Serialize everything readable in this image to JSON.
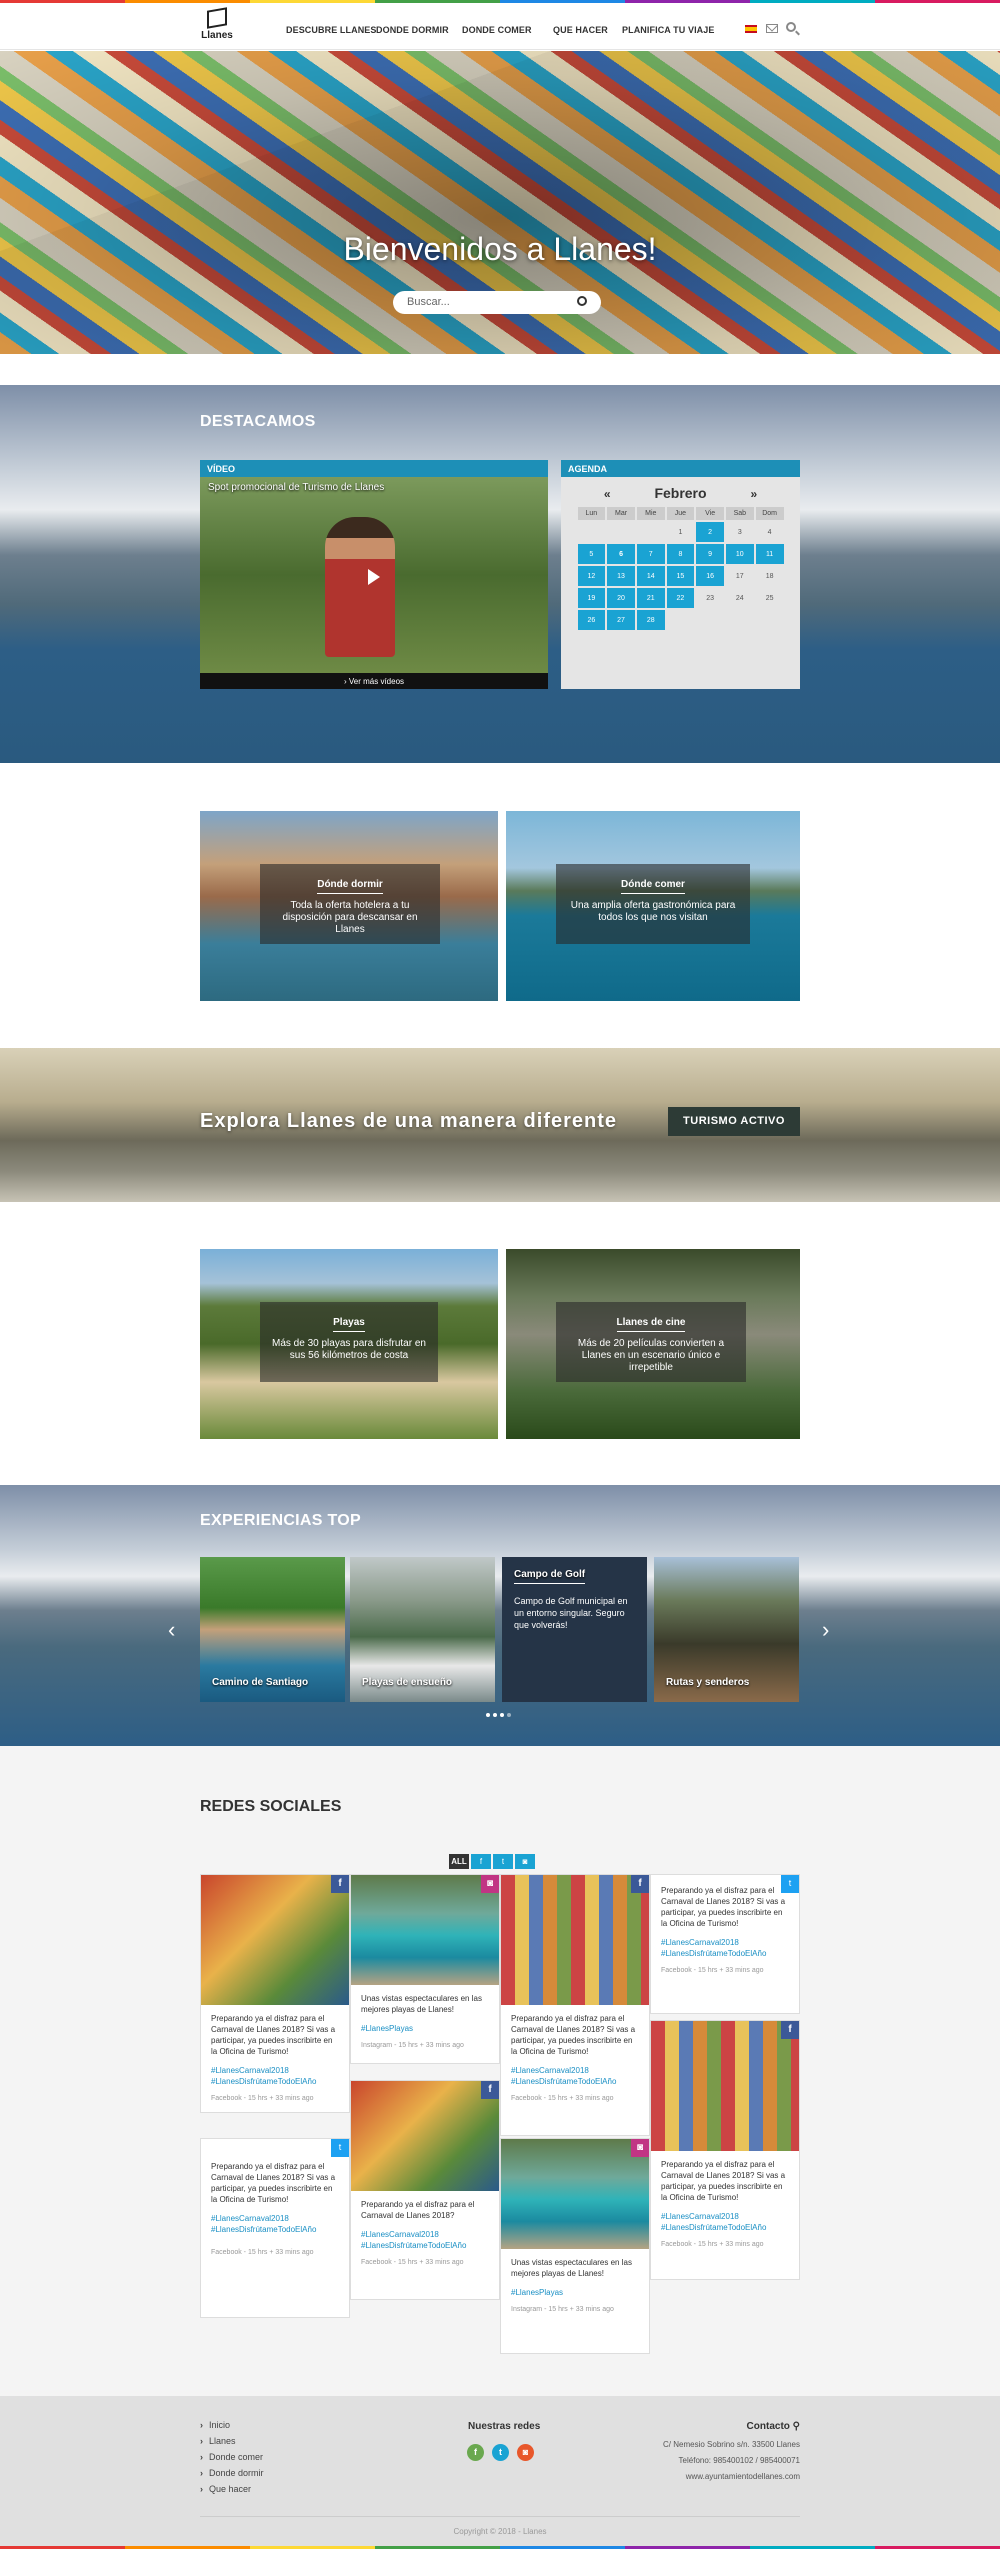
{
  "nav": {
    "logo_text": "Llanes",
    "links": [
      "DESCUBRE LLANES",
      "DONDE DORMIR",
      "DONDE COMER",
      "QUE HACER",
      "PLANIFICA TU VIAJE"
    ]
  },
  "hero": {
    "title": "Bienvenidos a Llanes!",
    "search_placeholder": "Buscar..."
  },
  "destacamos": {
    "title": "DESTACAMOS",
    "video": {
      "header": "VÍDEO",
      "title": "Spot promocional de Turismo de Llanes",
      "more": "Ver más vídeos"
    },
    "agenda": {
      "header": "AGENDA",
      "prev": "«",
      "month": "Febrero",
      "next": "»",
      "weekdays": [
        "Lun",
        "Mar",
        "Mie",
        "Jue",
        "Vie",
        "Sab",
        "Dom"
      ],
      "weeks": [
        [
          "",
          "",
          "",
          "1",
          "2",
          "3",
          "4"
        ],
        [
          "5",
          "6",
          "7",
          "8",
          "9",
          "10",
          "11"
        ],
        [
          "12",
          "13",
          "14",
          "15",
          "16",
          "17",
          "18"
        ],
        [
          "19",
          "20",
          "21",
          "22",
          "23",
          "24",
          "25"
        ],
        [
          "26",
          "27",
          "28",
          "",
          "",
          "",
          ""
        ]
      ]
    }
  },
  "tiles_1": [
    {
      "title": "Dónde dormir",
      "text": "Toda la oferta hotelera a tu disposición para descansar en Llanes"
    },
    {
      "title": "Dónde comer",
      "text": "Una amplia oferta gastronómica para todos los que nos visitan"
    }
  ],
  "explora": {
    "title": "Explora Llanes de una manera diferente",
    "button": "TURISMO ACTIVO"
  },
  "tiles_2": [
    {
      "title": "Playas",
      "text": "Más de 30 playas para disfrutar en sus 56 kilómetros de costa"
    },
    {
      "title": "Llanes de cine",
      "text": "Más de 20 películas convierten a Llanes en un escenario único e irrepetible"
    }
  ],
  "experiencias": {
    "title": "EXPERIENCIAS TOP",
    "cards": [
      {
        "label": "Camino de Santiago"
      },
      {
        "label": "Playas de ensueño"
      },
      {
        "label": "Campo de Golf",
        "text": "Campo de Golf municipal en un entorno singular. Seguro que volverás!"
      },
      {
        "label": "Rutas y senderos"
      }
    ]
  },
  "social": {
    "title": "REDES SOCIALES",
    "filter_all": "ALL",
    "posts": {
      "carnaval_long": "Preparando ya el disfraz para el Carnaval de Llanes 2018? Si vas a participar, ya puedes inscribirte en la Oficina de Turismo!",
      "carnaval_short": "Preparando ya el disfraz para el Carnaval de Llanes 2018?",
      "playas": "Unas vistas espectaculares en las mejores playas de Llanes!",
      "tag_carnaval": "#LlanesCarnaval2018",
      "tag_disfruta": "#LlanesDisfrútameTodoElAño",
      "tag_playas": "#LlanesPlayas",
      "meta_facebook": "Facebook - 15 hrs + 33 mins ago",
      "meta_instagram": "Instagram - 15 hrs + 33 mins ago"
    }
  },
  "footer": {
    "links": [
      "Inicio",
      "Llanes",
      "Donde comer",
      "Donde dormir",
      "Que hacer"
    ],
    "redes_title": "Nuestras redes",
    "contact_title": "Contacto",
    "address": "C/ Nemesio Sobrino s/n. 33500 Llanes",
    "phone": "Teléfono: 985400102 / 985400071",
    "web": "www.ayuntamientodellanes.com",
    "copyright": "Copyright © 2018 - Llanes"
  },
  "colors": {
    "accent": "#1aa3d3",
    "dark_button": "#2d3b36",
    "rainbow": [
      "#e53935",
      "#fb8c00",
      "#fdd835",
      "#43a047",
      "#1e88e5",
      "#8e24aa",
      "#00acc1",
      "#d81b60"
    ]
  }
}
